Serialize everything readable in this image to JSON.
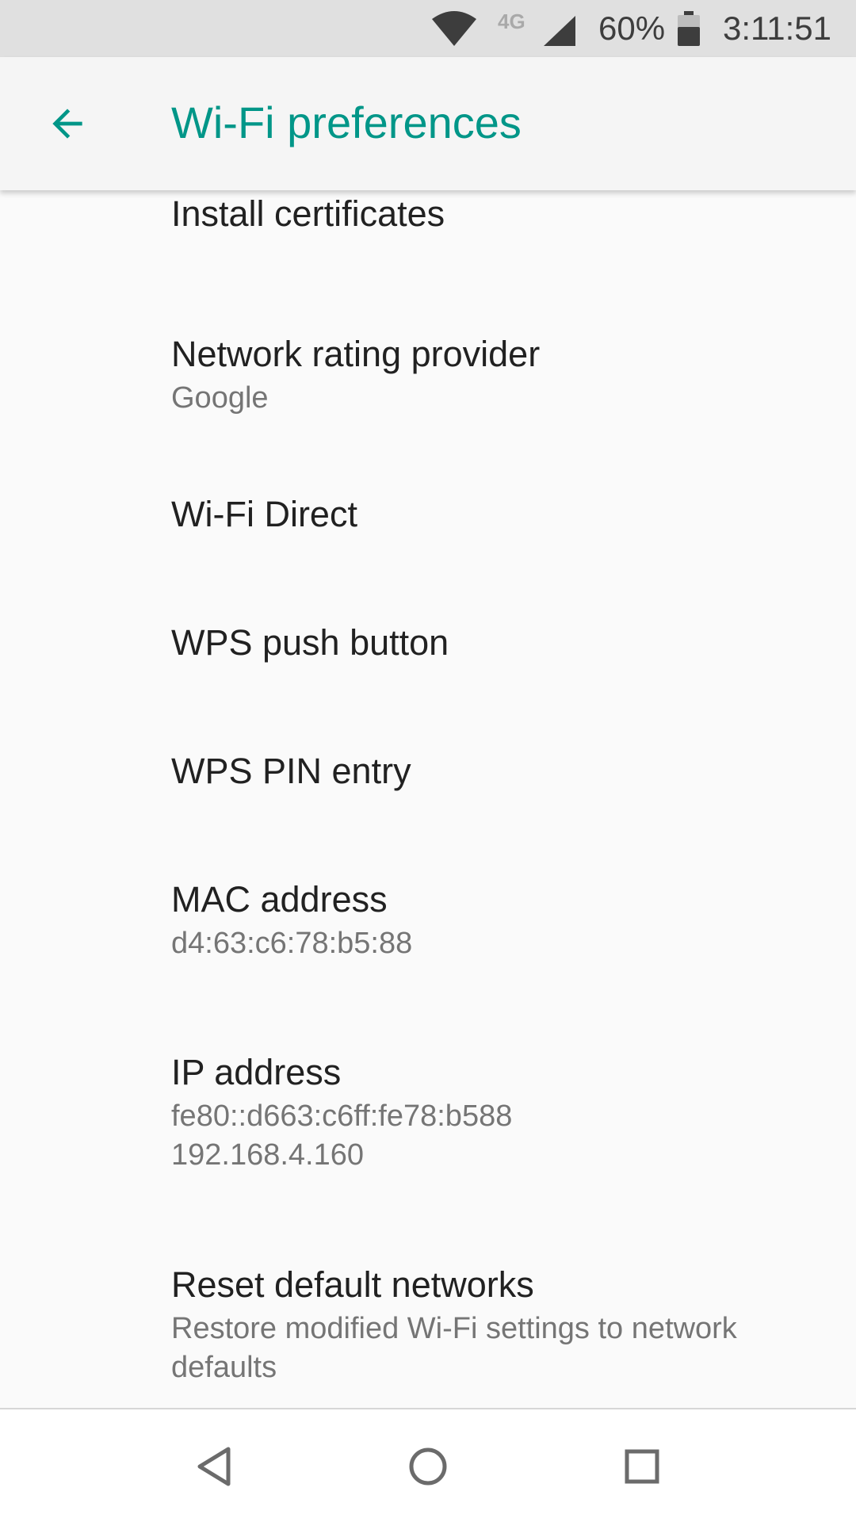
{
  "status_bar": {
    "network_type": "4G",
    "battery_percent": "60%",
    "time": "3:11:51",
    "icons": [
      "wifi-icon",
      "cell-signal-icon",
      "battery-icon"
    ]
  },
  "toolbar": {
    "back_icon": "arrow-back-icon",
    "title": "Wi-Fi preferences",
    "accent_color": "#009688"
  },
  "preferences": [
    {
      "title": "Install certificates"
    },
    {
      "title": "Network rating provider",
      "summary": "Google"
    },
    {
      "title": "Wi-Fi Direct"
    },
    {
      "title": "WPS push button"
    },
    {
      "title": "WPS PIN entry"
    },
    {
      "title": "MAC address",
      "summary": "d4:63:c6:78:b5:88"
    },
    {
      "title": "IP address",
      "summary_line1": "fe80::d663:c6ff:fe78:b588",
      "summary_line2": "192.168.4.160"
    },
    {
      "title": "Reset default networks",
      "summary": "Restore modified Wi-Fi settings to network defaults"
    }
  ],
  "nav_bar": {
    "icons": [
      "back-triangle-icon",
      "home-circle-icon",
      "recents-square-icon"
    ]
  }
}
